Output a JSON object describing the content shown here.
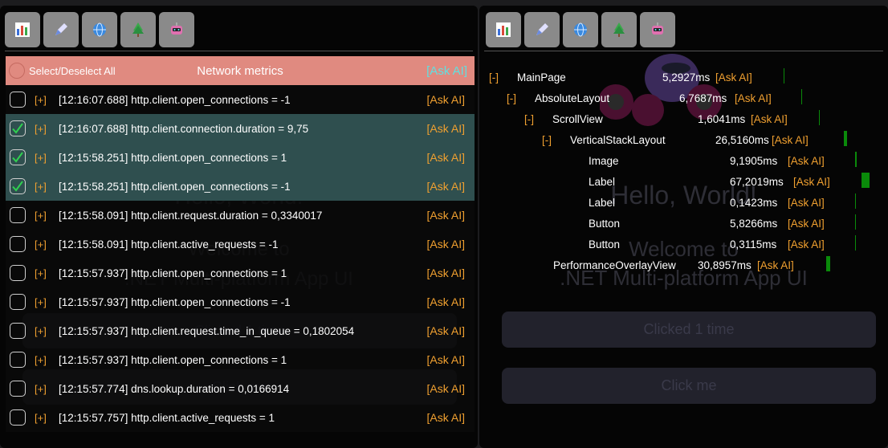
{
  "icons": [
    "chart-icon",
    "pen-icon",
    "globe-icon",
    "tree-icon",
    "robot-icon"
  ],
  "background_app": {
    "heading": "Hello, World!",
    "subheading_line1": "Welcome to",
    "subheading_line2": ".NET Multi-platform App UI",
    "button1_label": "Clicked 1 time",
    "button2_label": "Click me"
  },
  "metrics": {
    "select_all_label": "Select/Deselect All",
    "title": "Network metrics",
    "ask_ai_header": "[Ask AI]",
    "expand_symbol": "[+]",
    "ask_ai_label": "[Ask AI]",
    "rows": [
      {
        "text": "[12:16:07.688] http.client.open_connections = -1",
        "checked": false
      },
      {
        "text": "[12:16:07.688] http.client.connection.duration = 9,75",
        "checked": true
      },
      {
        "text": "[12:15:58.251] http.client.open_connections = 1",
        "checked": true
      },
      {
        "text": "[12:15:58.251] http.client.open_connections = -1",
        "checked": true
      },
      {
        "text": "[12:15:58.091] http.client.request.duration = 0,3340017",
        "checked": false
      },
      {
        "text": "[12:15:58.091] http.client.active_requests = -1",
        "checked": false
      },
      {
        "text": "[12:15:57.937] http.client.open_connections = 1",
        "checked": false
      },
      {
        "text": "[12:15:57.937] http.client.open_connections = -1",
        "checked": false
      },
      {
        "text": "[12:15:57.937] http.client.request.time_in_queue = 0,1802054",
        "checked": false
      },
      {
        "text": "[12:15:57.937] http.client.open_connections = 1",
        "checked": false
      },
      {
        "text": "[12:15:57.774] dns.lookup.duration = 0,0166914",
        "checked": false
      },
      {
        "text": "[12:15:57.757] http.client.active_requests = 1",
        "checked": false
      }
    ]
  },
  "tree": {
    "collapse_symbol": "[-]",
    "ask_ai_label": "[Ask AI]",
    "nodes": [
      {
        "name": "MainPage",
        "time": "5,2927ms",
        "depth": 0,
        "toggle": true,
        "bar": 0.1
      },
      {
        "name": "AbsoluteLayout",
        "time": "6,7687ms",
        "depth": 1,
        "toggle": true,
        "bar": 0.1
      },
      {
        "name": "ScrollView",
        "time": "1,6041ms",
        "depth": 2,
        "toggle": true,
        "bar": 0.05
      },
      {
        "name": "VerticalStackLayout",
        "time": "26,5160ms",
        "depth": 3,
        "toggle": true,
        "bar": 0.4
      },
      {
        "name": "Image",
        "time": "9,1905ms",
        "depth": 4,
        "toggle": false,
        "bar": 0.15
      },
      {
        "name": "Label",
        "time": "67,2019ms",
        "depth": 4,
        "toggle": false,
        "bar": 1.0
      },
      {
        "name": "Label",
        "time": "0,1423ms",
        "depth": 4,
        "toggle": false,
        "bar": 0.02
      },
      {
        "name": "Button",
        "time": "5,8266ms",
        "depth": 4,
        "toggle": false,
        "bar": 0.1
      },
      {
        "name": "Button",
        "time": "0,3115ms",
        "depth": 4,
        "toggle": false,
        "bar": 0.02
      },
      {
        "name": "PerformanceOverlayView",
        "time": "30,8957ms",
        "depth": 2,
        "toggle": false,
        "bar": 0.45
      }
    ]
  }
}
